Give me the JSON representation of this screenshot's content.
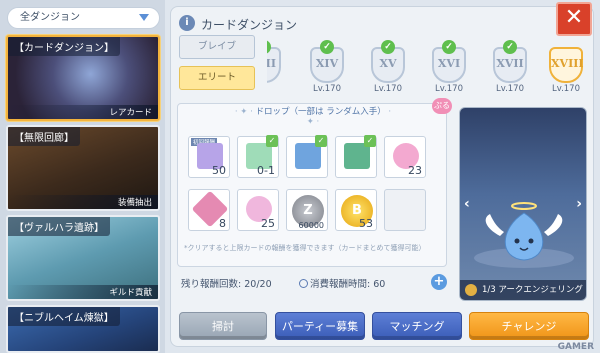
{
  "sidebar": {
    "dropdown_label": "全ダンジョン",
    "dungeons": [
      {
        "title": "【カードダンジョン】",
        "tag": "レアカード"
      },
      {
        "title": "【無限回廊】",
        "tag": "装備抽出"
      },
      {
        "title": "【ヴァルハラ遺跡】",
        "tag": "ギルド貢献"
      },
      {
        "title": "【ニブルヘイム煉獄】",
        "tag": ""
      }
    ]
  },
  "header": {
    "title": "カードダンジョン",
    "info_icon": "i",
    "close_icon": "✕"
  },
  "difficulty": {
    "normal_label": "ブレイブ",
    "elite_label": "エリート"
  },
  "levels": [
    {
      "numeral": "XIII",
      "lv": "",
      "cleared": true
    },
    {
      "numeral": "XIV",
      "lv": "Lv.170",
      "cleared": true
    },
    {
      "numeral": "XV",
      "lv": "Lv.170",
      "cleared": true
    },
    {
      "numeral": "XVI",
      "lv": "Lv.170",
      "cleared": true
    },
    {
      "numeral": "XVII",
      "lv": "Lv.170",
      "cleared": true
    },
    {
      "numeral": "XVIII",
      "lv": "Lv.170",
      "cleared": false
    }
  ],
  "drops": {
    "title": "ドロップ（一部は ランダム入手）",
    "badge": "ぷる",
    "items": [
      {
        "qty": "50",
        "color": "#b7a4e8",
        "check": false,
        "top_tag": "初回報酬"
      },
      {
        "qty": "0-1",
        "color": "#9fdcb8",
        "check": true,
        "top_tag": ""
      },
      {
        "qty": "",
        "color": "#6fa4de",
        "check": true,
        "top_tag": ""
      },
      {
        "qty": "",
        "color": "#5fb48e",
        "check": true,
        "top_tag": ""
      },
      {
        "qty": "23",
        "color": "#f3a9d0",
        "check": false,
        "top_tag": ""
      },
      {
        "qty": "8",
        "color": "#e58ab2",
        "check": false,
        "top_tag": ""
      },
      {
        "qty": "25",
        "color": "#f0b7dd",
        "check": false,
        "top_tag": ""
      },
      {
        "qty": "60000",
        "color": "#8d8f96",
        "check": false,
        "top_tag": "",
        "coin": "Z"
      },
      {
        "qty": "53",
        "color": "#f1c02e",
        "check": false,
        "top_tag": "",
        "coin": "B"
      },
      {
        "qty": "",
        "color": "#e9edf2",
        "check": false,
        "top_tag": ""
      }
    ],
    "note": "*クリアすると上限カードの報酬を獲得できます（カードまとめて獲得可能）"
  },
  "stats": {
    "remaining_label": "残り報酬回数",
    "remaining_value": "20/20",
    "time_label": "消費報酬時間",
    "time_value": "60"
  },
  "preview": {
    "caption": "1/3 アークエンジェリング"
  },
  "actions": {
    "sweep": "掃討",
    "party": "パーティー募集",
    "matching": "マッチング",
    "challenge": "チャレンジ"
  },
  "watermark": "GAMER"
}
